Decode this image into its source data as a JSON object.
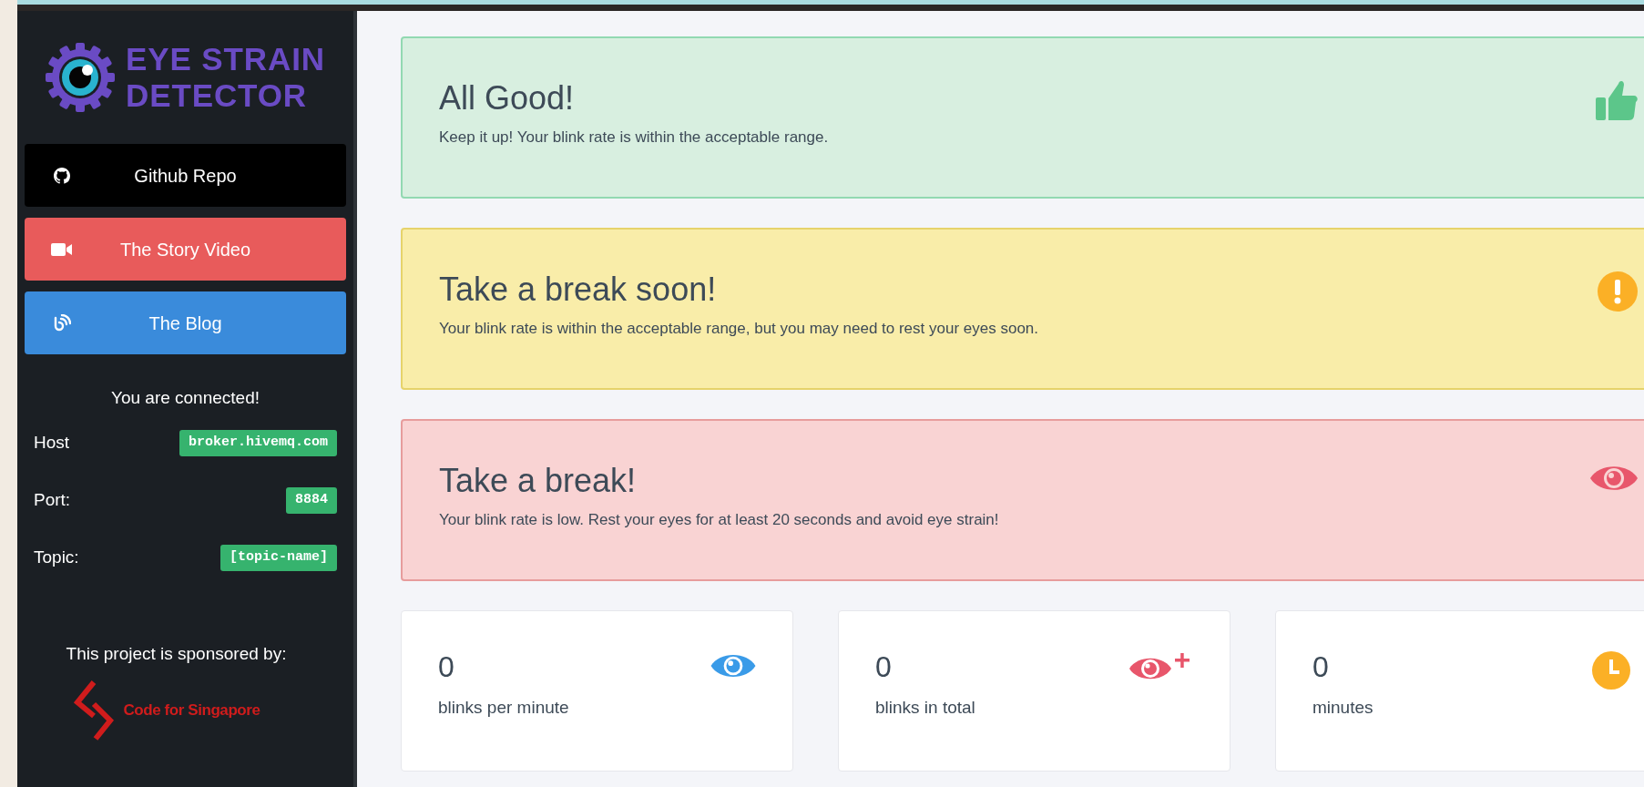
{
  "logo": {
    "line1": "EYE STRAIN",
    "line2": "DETECTOR"
  },
  "links": [
    {
      "kind": "github",
      "label": "Github Repo"
    },
    {
      "kind": "video",
      "label": "The Story Video"
    },
    {
      "kind": "blog",
      "label": "The Blog"
    }
  ],
  "connection": {
    "status": "You are connected!",
    "fields": [
      {
        "label": "Host",
        "value": "broker.hivemq.com"
      },
      {
        "label": "Port:",
        "value": "8884"
      },
      {
        "label": "Topic:",
        "value": "[topic-name]"
      }
    ]
  },
  "sponsor": {
    "text": "This project is sponsored by:",
    "name": "Code for Singapore"
  },
  "alerts": [
    {
      "kind": "success",
      "title": "All Good!",
      "message": "Keep it up! Your blink rate is within the acceptable range."
    },
    {
      "kind": "warning",
      "title": "Take a break soon!",
      "message": "Your blink rate is within the acceptable range, but you may need to rest your eyes soon."
    },
    {
      "kind": "danger",
      "title": "Take a break!",
      "message": "Your blink rate is low. Rest your eyes for at least 20 seconds and avoid eye strain!"
    }
  ],
  "stats": [
    {
      "kind": "rate",
      "value": "0",
      "label": "blinks per minute"
    },
    {
      "kind": "total",
      "value": "0",
      "label": "blinks in total"
    },
    {
      "kind": "time",
      "value": "0",
      "label": "minutes"
    }
  ]
}
